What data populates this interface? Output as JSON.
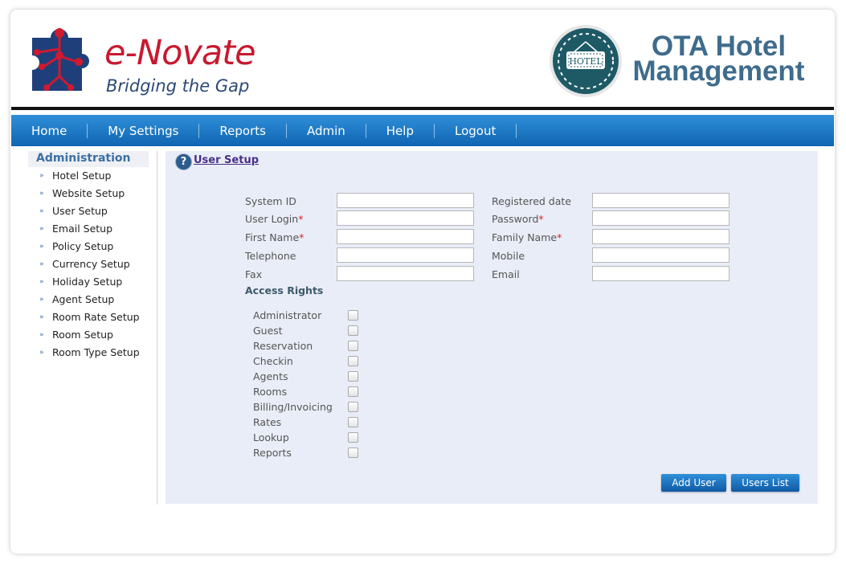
{
  "brand": {
    "name_e": "e-",
    "name_rest": "Novate",
    "tagline": "Bridging the Gap",
    "badge_text": "HOTEL",
    "colors": {
      "brand_red": "#c8192f",
      "brand_blue": "#2a4a78",
      "nav_blue": "#1f7ac6",
      "ota_title": "#3f6c8c"
    }
  },
  "app_title": {
    "line1": "OTA Hotel",
    "line2": "Management"
  },
  "nav": [
    "Home",
    "My Settings",
    "Reports",
    "Admin",
    "Help",
    "Logout"
  ],
  "sidebar": {
    "title": "Administration",
    "items": [
      "Hotel Setup",
      "Website Setup",
      "User Setup",
      "Email Setup",
      "Policy Setup",
      "Currency Setup",
      "Holiday Setup",
      "Agent Setup",
      "Room Rate Setup",
      "Room Setup",
      "Room Type Setup"
    ]
  },
  "panel": {
    "title": "User Setup",
    "fields": {
      "system_id": {
        "label": "System ID",
        "value": ""
      },
      "registered_date": {
        "label": "Registered date",
        "value": ""
      },
      "user_login": {
        "label": "User Login",
        "value": "",
        "required": true
      },
      "password": {
        "label": "Password",
        "value": "",
        "required": true
      },
      "first_name": {
        "label": "First Name",
        "value": "",
        "required": true
      },
      "family_name": {
        "label": "Family Name",
        "value": "",
        "required": true
      },
      "telephone": {
        "label": "Telephone",
        "value": ""
      },
      "mobile": {
        "label": "Mobile",
        "value": ""
      },
      "fax": {
        "label": "Fax",
        "value": ""
      },
      "email": {
        "label": "Email",
        "value": ""
      }
    },
    "required_mark": "*",
    "access_title": "Access Rights",
    "access_rights": [
      "Administrator",
      "Guest",
      "Reservation",
      "Checkin",
      "Agents",
      "Rooms",
      "Billing/Invoicing",
      "Rates",
      "Lookup",
      "Reports"
    ],
    "buttons": {
      "add_user": "Add User",
      "users_list": "Users List"
    }
  }
}
